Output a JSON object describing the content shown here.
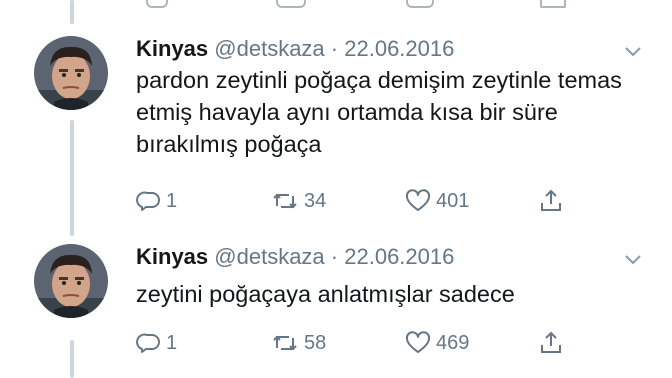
{
  "tweets": [
    {
      "author_name": "Kinyas",
      "author_handle": "@detskaza",
      "separator": "·",
      "date": "22.06.2016",
      "text": "pardon zeytinli poğaça demişim zeytinle temas etmiş havayla aynı ortamda kısa bir süre bırakılmış poğaça",
      "replies": "1",
      "retweets": "34",
      "likes": "401",
      "icons": {
        "reply": "reply-icon",
        "retweet": "retweet-icon",
        "like": "heart-icon",
        "share": "share-icon",
        "menu": "chevron-down-icon"
      }
    },
    {
      "author_name": "Kinyas",
      "author_handle": "@detskaza",
      "separator": "·",
      "date": "22.06.2016",
      "text": "zeytini poğaçaya anlatmışlar sadece",
      "replies": "1",
      "retweets": "58",
      "likes": "469",
      "icons": {
        "reply": "reply-icon",
        "retweet": "retweet-icon",
        "like": "heart-icon",
        "share": "share-icon",
        "menu": "chevron-down-icon"
      }
    }
  ],
  "colors": {
    "text": "#14171a",
    "secondary": "#657786",
    "thread_line": "#cdd6dd",
    "background": "#ffffff"
  }
}
